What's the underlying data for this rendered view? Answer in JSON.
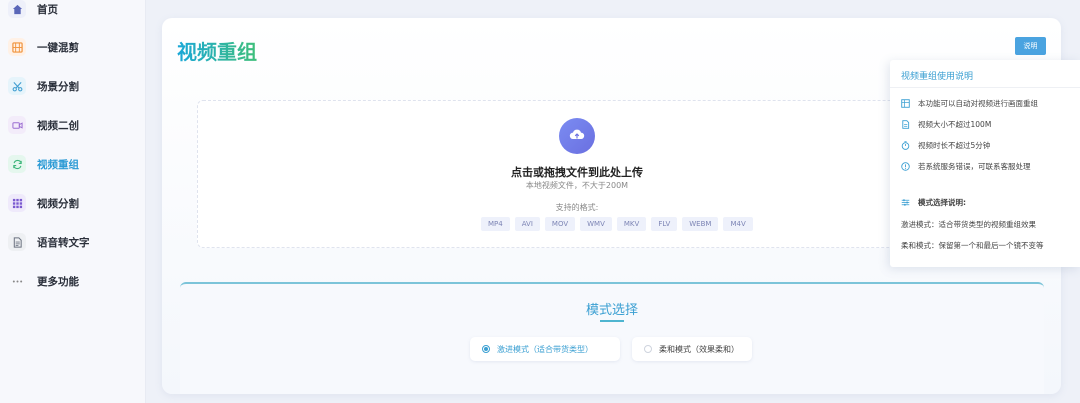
{
  "sidebar": {
    "items": [
      {
        "label": "首页",
        "icon": "home-icon",
        "color": "#eef0fa",
        "fg": "#5a66b8"
      },
      {
        "label": "一键混剪",
        "icon": "film-icon",
        "color": "#fff1e6",
        "fg": "#f0923a"
      },
      {
        "label": "场景分割",
        "icon": "scissors-icon",
        "color": "#e6f4fb",
        "fg": "#3b9bd0"
      },
      {
        "label": "视频二创",
        "icon": "video-icon",
        "color": "#f3ecfa",
        "fg": "#9b6fd1"
      },
      {
        "label": "视频重组",
        "icon": "refresh-icon",
        "color": "#e5f7ee",
        "fg": "#3cb57a"
      },
      {
        "label": "视频分割",
        "icon": "grid-icon",
        "color": "#efeafb",
        "fg": "#7b5ad0"
      },
      {
        "label": "语音转文字",
        "icon": "document-icon",
        "color": "#eef0f3",
        "fg": "#6b7280"
      },
      {
        "label": "更多功能",
        "icon": "more-icon",
        "color": "transparent",
        "fg": "#888"
      }
    ],
    "active_index": 4
  },
  "main": {
    "title": "视频重组",
    "help_button": "说明"
  },
  "upload": {
    "title": "点击或拖拽文件到此处上传",
    "subtitle": "本地视频文件，不大于200M",
    "formats_label": "支持的格式:",
    "formats": [
      "MP4",
      "AVI",
      "MOV",
      "WMV",
      "MKV",
      "FLV",
      "WEBM",
      "M4V"
    ]
  },
  "mode": {
    "title": "模式选择",
    "options": [
      {
        "label": "激进模式（适合带货类型）",
        "selected": true
      },
      {
        "label": "柔和模式（效果柔和）",
        "selected": false
      }
    ]
  },
  "help_popover": {
    "title": "视频重组使用说明",
    "items": [
      {
        "icon": "table-icon",
        "text": "本功能可以自动对视频进行画面重组"
      },
      {
        "icon": "file-icon",
        "text": "视频大小不超过100M"
      },
      {
        "icon": "timer-icon",
        "text": "视频时长不超过5分钟"
      },
      {
        "icon": "info-icon",
        "text": "若系统服务错误，可联系客服处理"
      }
    ],
    "mode_heading": "模式选择说明:",
    "mode_lines": [
      "激进模式：适合带货类型的视频重组效果",
      "柔和模式：保留第一个和最后一个镜不变等"
    ]
  }
}
